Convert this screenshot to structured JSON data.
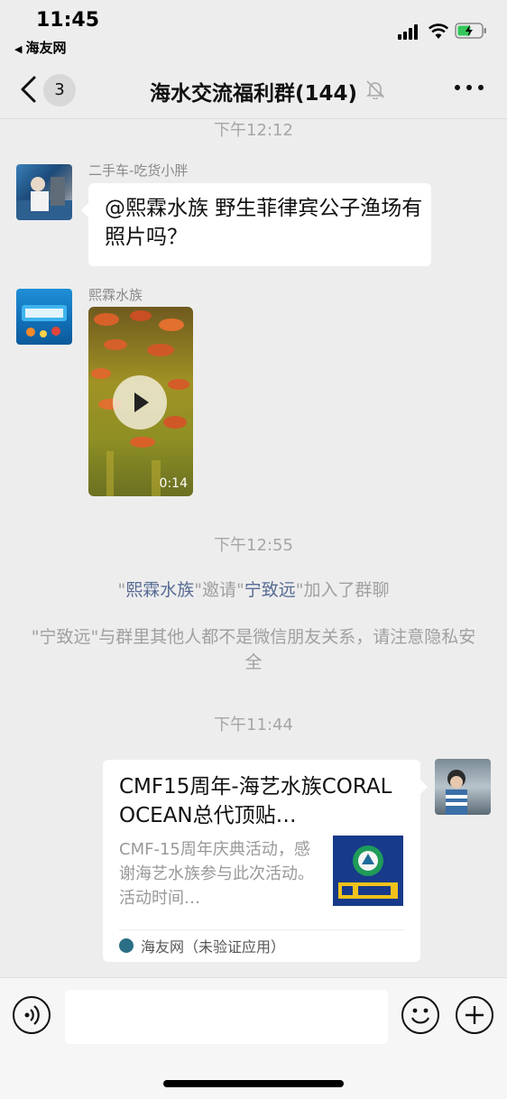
{
  "status": {
    "time": "11:45",
    "back_app": "海友网"
  },
  "nav": {
    "unread": "3",
    "title": "海水交流福利群(144)"
  },
  "messages": {
    "ts1": "下午12:12",
    "msg1": {
      "sender": "二手车-吃货小胖",
      "text": "@熙霖水族 野生菲律宾公子渔场有照片吗？"
    },
    "msg2": {
      "sender": "熙霖水族",
      "video_duration": "0:14"
    },
    "ts2": "下午12:55",
    "sys1": {
      "q1": "\"",
      "inviter": "熙霖水族",
      "mid": "\"邀请\"",
      "invitee": "宁致远",
      "end": "\"加入了群聊"
    },
    "sys2": "\"宁致远\"与群里其他人都不是微信朋友关系，请注意隐私安全",
    "ts3": "下午11:44",
    "card": {
      "title": "CMF15周年-海艺水族CORAL OCEAN总代顶贴…",
      "desc": "CMF-15周年庆典活动，感谢海艺水族参与此次活动。活动时间…",
      "source": "海友网（未验证应用）"
    }
  },
  "colors": {
    "background": "#ededed",
    "link": "#576b95",
    "bubble": "#ffffff"
  }
}
